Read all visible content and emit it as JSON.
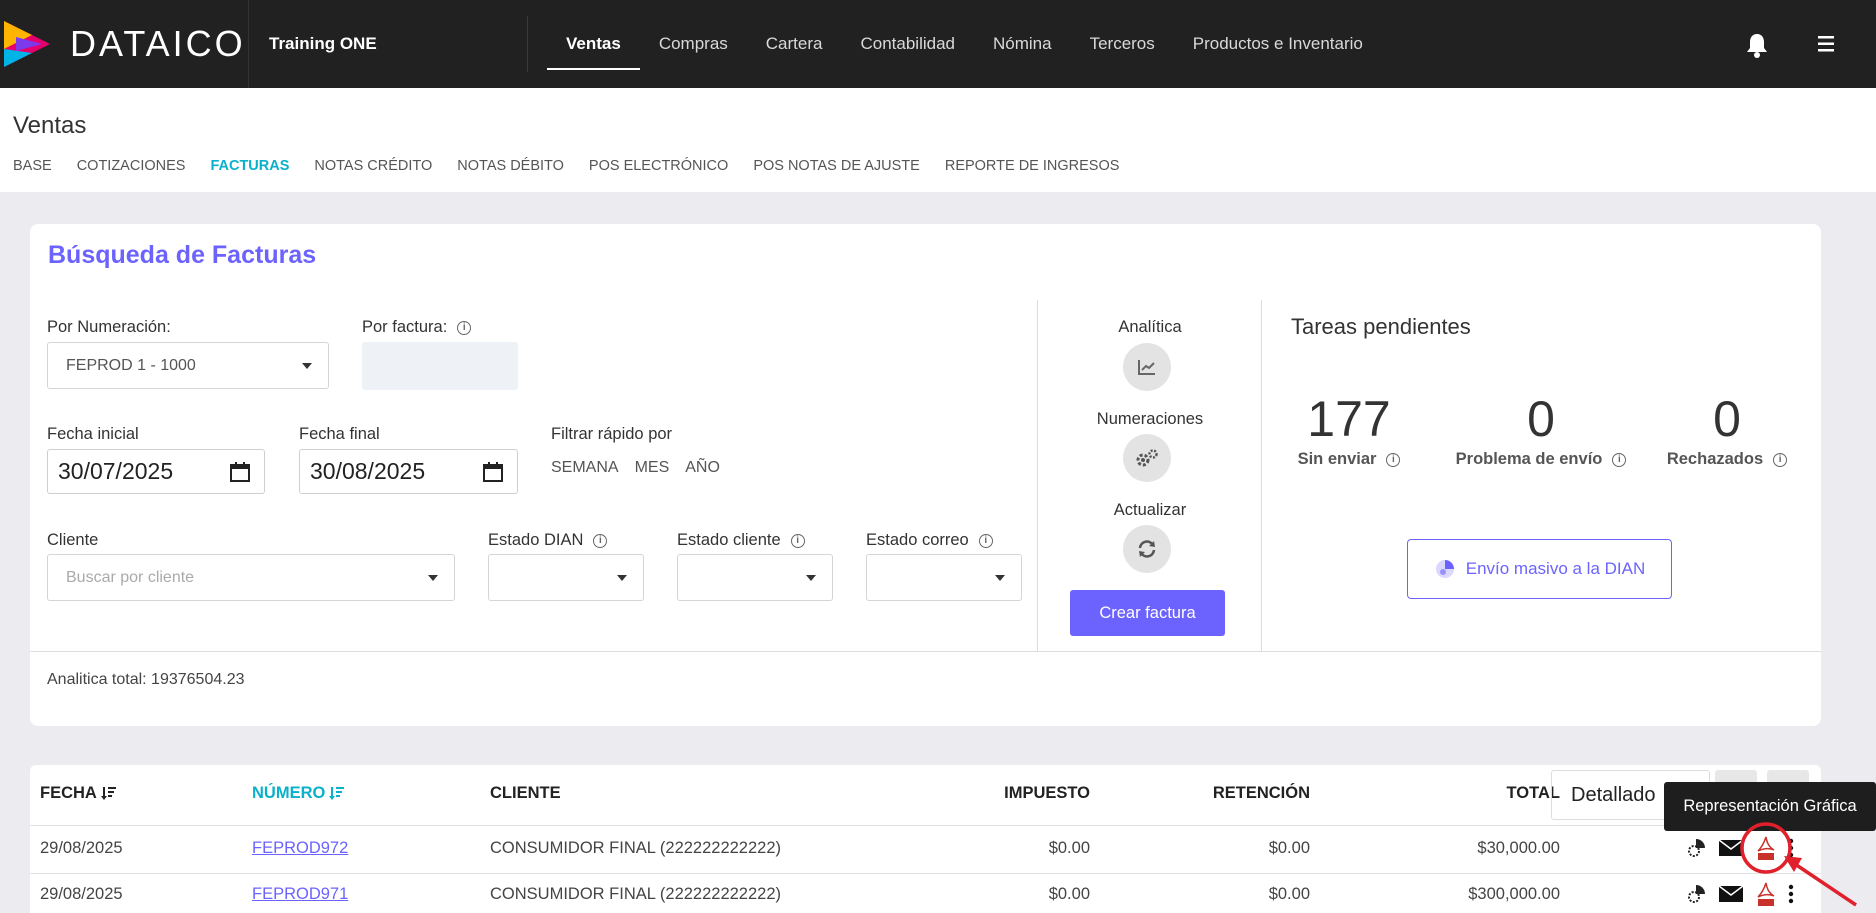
{
  "brand": {
    "name": "DATAICO",
    "company": "Training ONE"
  },
  "nav": {
    "items": [
      "Ventas",
      "Compras",
      "Cartera",
      "Contabilidad",
      "Nómina",
      "Terceros",
      "Productos e Inventario"
    ],
    "active": "Ventas"
  },
  "page": {
    "title": "Ventas",
    "tabs": [
      "BASE",
      "COTIZACIONES",
      "FACTURAS",
      "NOTAS CRÉDITO",
      "NOTAS DÉBITO",
      "POS ELECTRÓNICO",
      "POS NOTAS DE AJUSTE",
      "REPORTE DE INGRESOS"
    ],
    "active_tab": "FACTURAS"
  },
  "search": {
    "title": "Búsqueda de Facturas",
    "numeracion_label": "Por Numeración:",
    "numeracion_value": "FEPROD 1 - 1000",
    "factura_label": "Por factura:",
    "fecha_inicial_label": "Fecha inicial",
    "fecha_inicial_value": "30/07/2025",
    "fecha_final_label": "Fecha final",
    "fecha_final_value": "30/08/2025",
    "filtrar_label": "Filtrar rápido por",
    "quick": [
      "SEMANA",
      "MES",
      "AÑO"
    ],
    "cliente_label": "Cliente",
    "cliente_placeholder": "Buscar por cliente",
    "estado_dian_label": "Estado DIAN",
    "estado_cliente_label": "Estado cliente",
    "estado_correo_label": "Estado correo",
    "analytics_total": "Analitica total: 19376504.23"
  },
  "side": {
    "analitica": "Analítica",
    "numeraciones": "Numeraciones",
    "actualizar": "Actualizar",
    "create_button": "Crear factura"
  },
  "tasks": {
    "title": "Tareas pendientes",
    "stats": [
      {
        "value": "177",
        "label": "Sin enviar"
      },
      {
        "value": "0",
        "label": "Problema de envío"
      },
      {
        "value": "0",
        "label": "Rechazados"
      }
    ],
    "mass_button": "Envío masivo a la DIAN"
  },
  "table": {
    "headers": {
      "fecha": "FECHA",
      "numero": "NÚMERO",
      "cliente": "CLIENTE",
      "impuesto": "IMPUESTO",
      "retencion": "RETENCIÓN",
      "total": "TOTAL"
    },
    "view_select": "Detallado",
    "rows": [
      {
        "fecha": "29/08/2025",
        "numero": "FEPROD972",
        "cliente": "CONSUMIDOR FINAL (222222222222)",
        "impuesto": "$0.00",
        "retencion": "$0.00",
        "total": "$30,000.00"
      },
      {
        "fecha": "29/08/2025",
        "numero": "FEPROD971",
        "cliente": "CONSUMIDOR FINAL (222222222222)",
        "impuesto": "$0.00",
        "retencion": "$0.00",
        "total": "$300,000.00"
      }
    ]
  },
  "tooltip": "Representación Gráfica",
  "colors": {
    "accent": "#6c63ff",
    "tab_active": "#0ab1ca",
    "topbar": "#212121",
    "annotation": "#e0202a"
  },
  "icons": [
    "bell-icon",
    "hamburger-menu-icon",
    "chart-icon",
    "gears-icon",
    "refresh-icon",
    "calendar-icon",
    "info-icon",
    "dian-icon",
    "mail-icon",
    "pdf-icon",
    "kebab-icon",
    "sort-icon"
  ]
}
